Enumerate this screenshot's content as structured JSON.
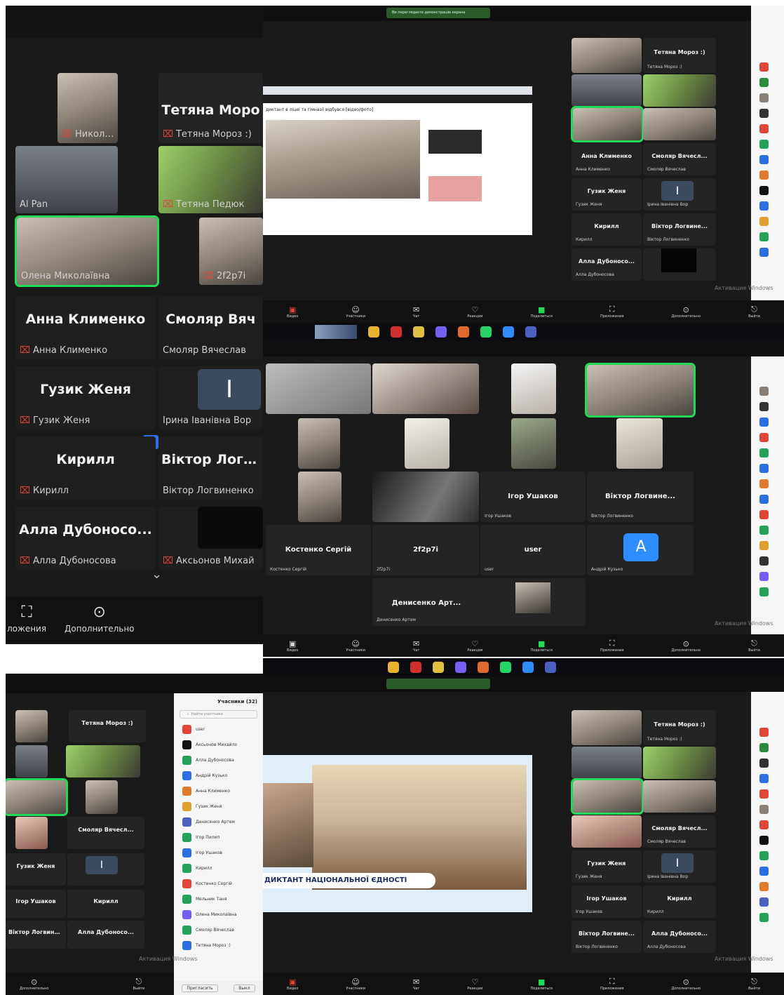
{
  "colors": {
    "dark_bg": "#1a1a1a",
    "tile_bg": "#242424",
    "active_speaker": "#23d959",
    "mic_muted": "#e0453a",
    "share_blue": "#2d8cff",
    "avatar_blue": "#1d6fe0"
  },
  "panel_a": {
    "toolbar": {
      "layout_label": "ложения",
      "more_label": "Дополнительно",
      "layout_icon": "gallery-view-icon",
      "more_icon": "more-dots-icon"
    },
    "tiles": [
      {
        "small": "Николай Тамко"
      },
      {
        "big": "Тетяна Моро",
        "small": "Тетяна Мороз :)"
      },
      {
        "small": "Al Pan"
      },
      {
        "small": "Тетяна Педюк"
      },
      {
        "small": "Олена Миколаївна"
      },
      {
        "small": "2f2p7i"
      },
      {
        "big": "Анна Клименко",
        "small": "Анна Клименко"
      },
      {
        "big": "Смоляр Вяч",
        "small": "Смоляр Вячеслав"
      },
      {
        "big": "Гузик Женя",
        "small": "Гузик Женя"
      },
      {
        "letter": "І",
        "small": "Ірина Іванівна Вор"
      },
      {
        "big": "Кирилл",
        "small": "Кирилл"
      },
      {
        "big": "Віктор Логви",
        "small": "Віктор Логвиненко"
      },
      {
        "big": "Алла Дубоносо...",
        "small": "Алла Дубоносова"
      },
      {
        "small": "Аксьонов Михай"
      }
    ]
  },
  "panel_b": {
    "share_badge": "Ви переглядаєте демонстрацію екрана",
    "article_title": "диктант в ліцеї та гімназії відбувся [відео/фото]",
    "tiles": [
      {
        "big": "Тетяна Мороз :)",
        "small": "Тетяна Мороз :)"
      },
      {
        "big": "Анна Клименко",
        "small": "Анна Клименко"
      },
      {
        "big": "Смоляр Вячесл...",
        "small": "Смоляр Вячеслав"
      },
      {
        "big": "Гузик Женя",
        "small": "Гузик Женя"
      },
      {
        "letter": "І",
        "small": "Ірина Іванівна Вор"
      },
      {
        "big": "Кирилл",
        "small": "Кирилл"
      },
      {
        "big": "Віктор Логвине...",
        "small": "Віктор Логвиненко"
      },
      {
        "big": "Алла Дубоносо...",
        "small": "Алла Дубоносова"
      }
    ]
  },
  "panel_c": {
    "tiles": [
      {
        "big": "Ігор Ушаков",
        "small": "Ігор Ушаков"
      },
      {
        "big": "Віктор Логвине...",
        "small": "Віктор Логвиненко"
      },
      {
        "big": "Костенко Сергій",
        "small": "Костенко Сергій"
      },
      {
        "big": "2f2p7i",
        "small": "2f2p7i"
      },
      {
        "big": "user",
        "small": "user"
      },
      {
        "letter": "A",
        "small": "Андрій Кузько"
      },
      {
        "big": "Денисенко Арт...",
        "small": "Денисенко Артем"
      }
    ]
  },
  "panel_d": {
    "participants_title": "Учасники (32)",
    "search_placeholder": "Найти участника",
    "tiles": [
      {
        "big": "Тетяна Мороз :)",
        "small": "Тетяна Мороз :)"
      },
      {
        "big": "Смоляр Вячесл...",
        "small": "Смоляр Вячеслав"
      },
      {
        "big": "Гузик Женя",
        "small": "Гузик Женя"
      },
      {
        "letter": "І",
        "small": "Ірина Іванівна Вор"
      },
      {
        "big": "Ігор Ушаков",
        "small": "Ігор Ушаков"
      },
      {
        "big": "Кирилл",
        "small": "Кирилл"
      },
      {
        "big": "Віктор Логвине...",
        "small": "Віктор Логвиненко"
      },
      {
        "big": "Алла Дубоносо...",
        "small": "Алла Дубоносова"
      }
    ],
    "participants": [
      "user",
      "Аксьонов Михайло",
      "Алла Дубоносова",
      "Андрій Кузько",
      "Анна Клименко",
      "Гузик Женя",
      "Денисенко Артем",
      "Ігор Пилип",
      "Ігор Ушаков",
      "Кирилл",
      "Костенко Сергій",
      "Мельник Таня",
      "Олена Миколаївна",
      "Смоляр Вячеслав",
      "Тетяна Мороз :)"
    ],
    "footer_buttons": [
      "Пригласить",
      "Выкл"
    ]
  },
  "panel_e": {
    "banner_text": "ДИКТАНТ НАЦІОНАЛЬНОЇ ЄДНОСТІ",
    "tiles": [
      {
        "big": "Тетяна Мороз :)",
        "small": "Тетяна Мороз :)"
      },
      {
        "big": "Смоляр Вячесл...",
        "small": "Смоляр Вячеслав"
      },
      {
        "big": "Гузик Женя",
        "small": "Гузик Женя"
      },
      {
        "letter": "І",
        "small": "Ірина Іванівна Вор"
      },
      {
        "big": "Ігор Ушаков",
        "small": "Ігор Ушаков"
      },
      {
        "big": "Кирилл",
        "small": "Кирилл"
      },
      {
        "big": "Віктор Логвине...",
        "small": "Віктор Логвиненко"
      },
      {
        "big": "Алла Дубоносо...",
        "small": "Алла Дубоносова"
      }
    ]
  },
  "toolbar_labels": {
    "video": "Видео",
    "participants": "Участники",
    "chat": "Чат",
    "reactions": "Реакции",
    "share": "Поделиться",
    "apps": "Приложения",
    "more": "Дополнительно",
    "leave": "Выйти"
  },
  "toolbar_icons": {
    "video": "video-camera-icon",
    "participants": "participants-icon",
    "chat": "chat-bubble-icon",
    "reactions": "heart-icon",
    "share": "share-screen-icon",
    "apps": "apps-icon",
    "more": "more-dots-icon",
    "leave": "leave-icon"
  },
  "watermark": "Активация Windows"
}
